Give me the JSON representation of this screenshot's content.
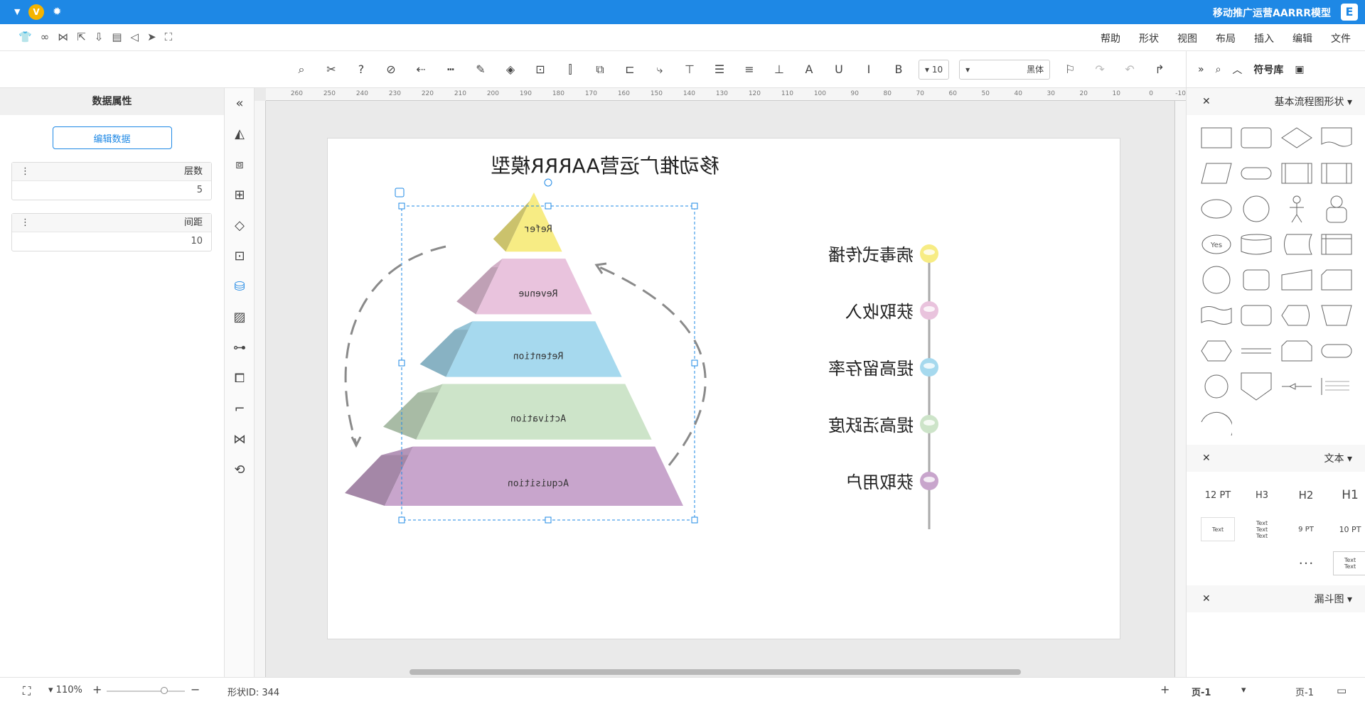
{
  "titlebar": {
    "app_logo": "E",
    "title": "移动推广运营AARRR模型"
  },
  "menu": {
    "items": [
      "文件",
      "编辑",
      "插入",
      "布局",
      "视图",
      "形状",
      "帮助"
    ]
  },
  "toolbar": {
    "font_name": "黑体",
    "font_size": "10"
  },
  "symbols_panel": {
    "label": "符号库"
  },
  "left_panel": {
    "title": "数据属性",
    "edit_button": "编辑数据",
    "props": [
      {
        "key": "层数",
        "value": "5"
      },
      {
        "key": "间距",
        "value": "10"
      }
    ]
  },
  "right_panel": {
    "sections": [
      {
        "title": "基本流程图形状"
      },
      {
        "title": "文本",
        "items": [
          "H1",
          "H2",
          "H3",
          "12 PT",
          "10 PT",
          "9 PT"
        ]
      },
      {
        "title": "漏斗图"
      }
    ],
    "flow_yes_label": "Yes",
    "text_sample": "Text"
  },
  "ruler": {
    "ticks": [
      "-10",
      "0",
      "10",
      "20",
      "30",
      "40",
      "50",
      "60",
      "70",
      "80",
      "90",
      "100",
      "110",
      "120",
      "130",
      "140",
      "150",
      "160",
      "170",
      "180",
      "190",
      "200",
      "210",
      "220",
      "230",
      "240",
      "250",
      "260"
    ]
  },
  "diagram": {
    "title": "移动推广运营AARRR模型",
    "layers": [
      {
        "label": "Refer",
        "color": "#f7ec84"
      },
      {
        "label": "Revenue",
        "color": "#e9c3dd"
      },
      {
        "label": "Retention",
        "color": "#a6d9ee"
      },
      {
        "label": "Activation",
        "color": "#cde4c9"
      },
      {
        "label": "Acquisition",
        "color": "#c8a5cc"
      }
    ],
    "timeline": [
      {
        "text": "病毒式传播",
        "color": "#f7ec84"
      },
      {
        "text": "获取收入",
        "color": "#e9c3dd"
      },
      {
        "text": "提高留存率",
        "color": "#a6d9ee"
      },
      {
        "text": "提高活跃度",
        "color": "#cde4c9"
      },
      {
        "text": "获取用户",
        "color": "#c8a5cc"
      }
    ]
  },
  "status": {
    "shape_id": "形状ID: 344",
    "zoom": "110%",
    "page_tab": "页-1",
    "page_selector": "页-1"
  }
}
